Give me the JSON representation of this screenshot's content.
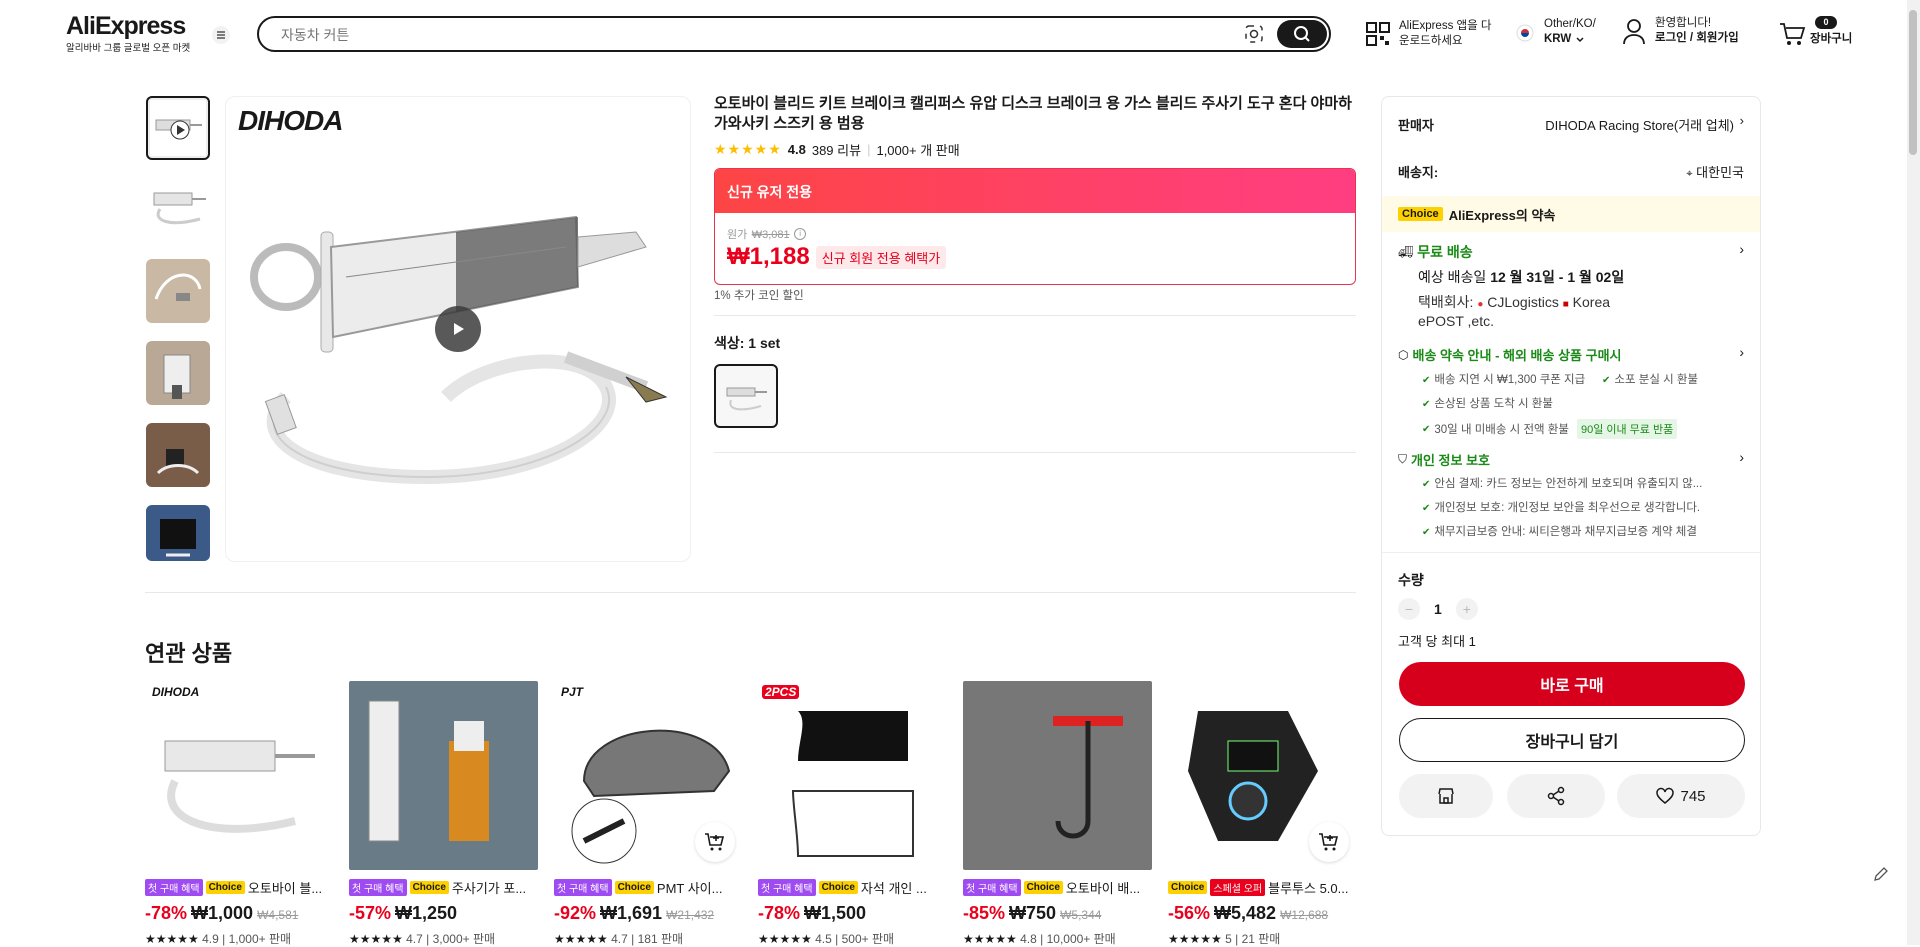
{
  "header": {
    "logo": "AliExpress",
    "logo_sub": "알리바바 그룹 글로벌 오픈 마켓",
    "search_placeholder": "자동차 커튼",
    "app_download_line1": "AliExpress 앱을 다",
    "app_download_line2": "운로드하세요",
    "region_line1": "Other/KO/",
    "region_line2": "KRW",
    "welcome": "환영합니다!",
    "login": "로그인 / 회원가입",
    "cart_count": "0",
    "cart_label": "장바구니"
  },
  "product": {
    "brand_logo": "DIHODA",
    "title": "오토바이 블리드 키트 브레이크 캘리퍼스 유압 디스크 브레이크 용 가스 블리드 주사기 도구 혼다 야마하 가와사키 스즈키 용 범용",
    "rating": "4.8",
    "rating_value": 4.8,
    "reviews": "389 리뷰",
    "sold": "1,000+ 개 판매",
    "promo_banner": "신규 유저 전용",
    "original_label": "원가",
    "original_price": "₩3,081",
    "price": "₩1,188",
    "price_badge": "신규 회원 전용 혜택가",
    "coin_discount": "1% 추가 코인 할인",
    "color_label": "색상: 1 set"
  },
  "panel": {
    "seller_label": "판매자",
    "seller_name": "DIHODA Racing Store(거래 업체)",
    "ship_to_label": "배송지:",
    "ship_to_value": "대한민국",
    "choice_tag": "Choice",
    "choice_promise": "AliExpress의 약속",
    "free_shipping": "무료 배송",
    "delivery_prefix": "예상 배송일",
    "delivery_dates": "12 월 31일 - 1 월 02일",
    "carrier_prefix": "택배회사:",
    "carrier_1": "CJLogistics",
    "carrier_2": "Korea",
    "carrier_3": "ePOST ,etc.",
    "promise_title": "배송 약속 안내 - 해외 배송 상품 구매시",
    "promise_items": [
      "배송 지연 시 ₩1,300 쿠폰 지급",
      "소포 분실 시 환불",
      "손상된 상품 도착 시 환불",
      "30일 내 미배송 시 전액 환불"
    ],
    "free_return": "90일 이내 무료 반품",
    "privacy_title": "개인 정보 보호",
    "privacy_items": [
      "안심 결제: 카드 정보는 안전하게 보호되며 유출되지 않...",
      "개인정보 보호: 개인정보 보안을 최우선으로 생각합니다.",
      "채무지급보증 안내: 씨티은행과 채무지급보증 계약 체결"
    ],
    "qty_label": "수량",
    "qty_value": "1",
    "qty_limit": "고객 당 최대 1",
    "buy_now": "바로 구매",
    "add_to_cart": "장바구니 담기",
    "wishlist_count": "745"
  },
  "related": {
    "title": "연관 상품",
    "items": [
      {
        "tags": [
          "첫 구매 혜택",
          "Choice"
        ],
        "name": "오토바이 블...",
        "discount": "-78%",
        "price": "₩1,000",
        "original": "₩4,581",
        "rating": "4.9",
        "sold": "1,000+ 판매",
        "image": "syringe",
        "corner": "DIHODA",
        "cart": false
      },
      {
        "tags": [
          "첫 구매 혜택",
          "Choice"
        ],
        "name": "주사기가 포...",
        "discount": "-57%",
        "price": "₩1,250",
        "original": "",
        "rating": "4.7",
        "sold": "3,000+ 판매",
        "image": "syringe-fluid",
        "corner": "",
        "cart": false
      },
      {
        "tags": [
          "첫 구매 혜택",
          "Choice"
        ],
        "name": "PMT 사이...",
        "discount": "-92%",
        "price": "₩1,691",
        "original": "₩21,432",
        "rating": "4.7",
        "sold": "181 판매",
        "image": "helmet",
        "corner": "PJT",
        "cart": true
      },
      {
        "tags": [
          "첫 구매 혜택",
          "Choice"
        ],
        "name": "자석 개인 ...",
        "discount": "-78%",
        "price": "₩1,500",
        "original": "",
        "rating": "4.5",
        "sold": "500+ 판매",
        "image": "window-shade",
        "corner": "2PCS",
        "cart": false
      },
      {
        "tags": [
          "첫 구매 혜택",
          "Choice"
        ],
        "name": "오토바이 배...",
        "discount": "-85%",
        "price": "₩750",
        "original": "₩5,344",
        "rating": "4.8",
        "sold": "10,000+ 판매",
        "image": "hook-tool",
        "corner": "",
        "cart": false
      },
      {
        "tags": [
          "Choice",
          "스페셜 오퍼"
        ],
        "name": "블루투스 5.0...",
        "discount": "-56%",
        "price": "₩5,482",
        "original": "₩12,688",
        "rating": "5",
        "sold": "21 판매",
        "image": "car-charger",
        "corner": "",
        "cart": true
      }
    ]
  },
  "colors": {
    "accent_red": "#e8001c",
    "brand_red": "#d6001c",
    "choice_yellow": "#fdd000",
    "green": "#1a8917",
    "purple": "#9e4bf2"
  }
}
